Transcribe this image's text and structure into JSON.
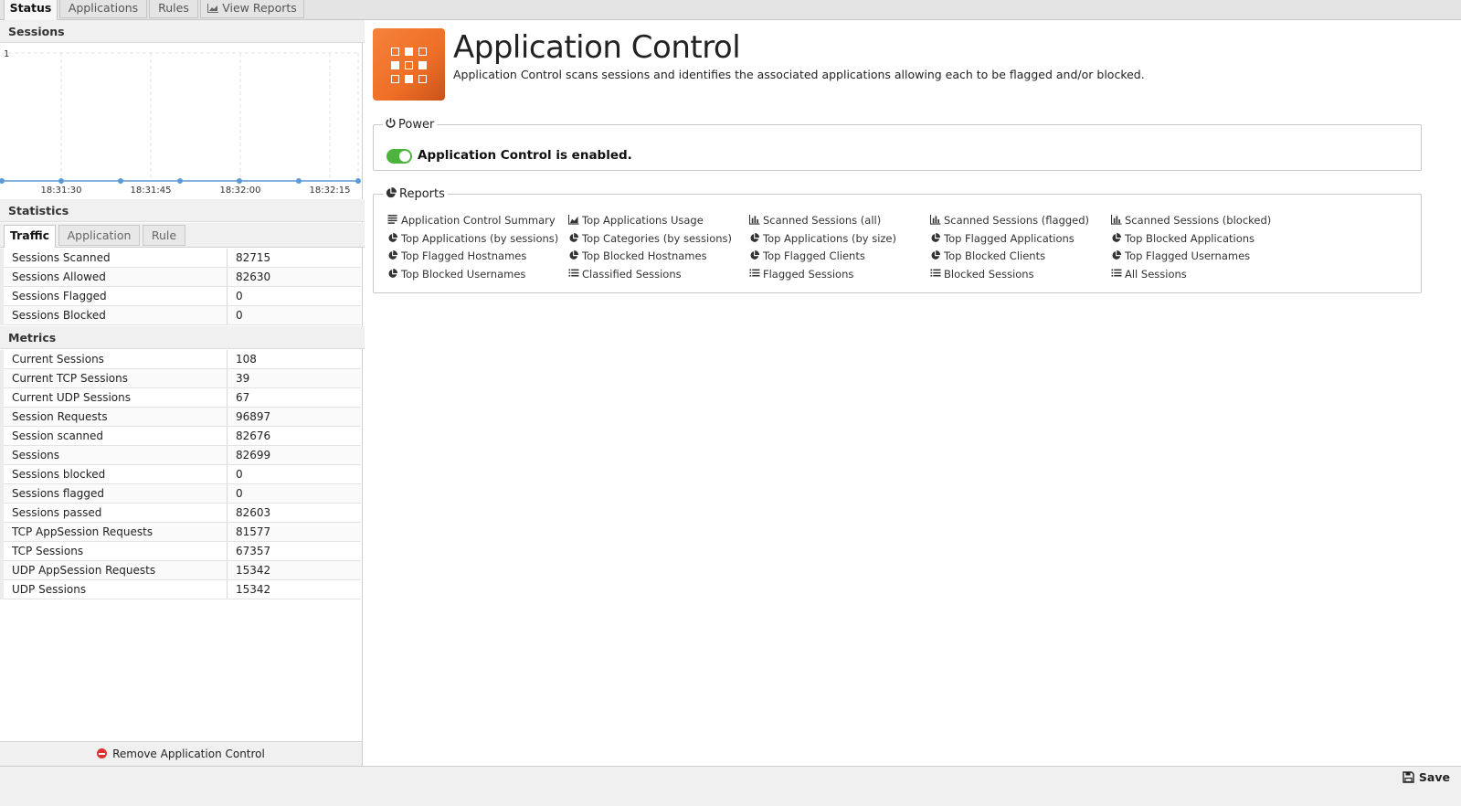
{
  "tabs": [
    {
      "label": "Status",
      "active": true
    },
    {
      "label": "Applications",
      "active": false
    },
    {
      "label": "Rules",
      "active": false
    },
    {
      "label": "View Reports",
      "active": false
    }
  ],
  "sessions": {
    "header": "Sessions",
    "chart_data": {
      "type": "line",
      "title": "",
      "x": [
        "18:31:30",
        "18:31:45",
        "18:32:00",
        "18:32:15"
      ],
      "ylim": [
        0,
        1
      ],
      "y_tick_labels": [
        "1"
      ],
      "series": [
        {
          "name": "",
          "values": [
            0,
            0,
            0,
            0,
            0,
            0,
            0
          ]
        }
      ],
      "grid": true,
      "legend": "none"
    }
  },
  "statistics": {
    "header": "Statistics",
    "tabs": [
      "Traffic",
      "Application",
      "Rule"
    ],
    "rows": [
      {
        "label": "Sessions Scanned",
        "value": "82715"
      },
      {
        "label": "Sessions Allowed",
        "value": "82630"
      },
      {
        "label": "Sessions Flagged",
        "value": "0"
      },
      {
        "label": "Sessions Blocked",
        "value": "0"
      }
    ]
  },
  "metrics": {
    "header": "Metrics",
    "rows": [
      {
        "label": "Current Sessions",
        "value": "108"
      },
      {
        "label": "Current TCP Sessions",
        "value": "39"
      },
      {
        "label": "Current UDP Sessions",
        "value": "67"
      },
      {
        "label": "Session Requests",
        "value": "96897"
      },
      {
        "label": "Session scanned",
        "value": "82676"
      },
      {
        "label": "Sessions",
        "value": "82699"
      },
      {
        "label": "Sessions blocked",
        "value": "0"
      },
      {
        "label": "Sessions flagged",
        "value": "0"
      },
      {
        "label": "Sessions passed",
        "value": "82603"
      },
      {
        "label": "TCP AppSession Requests",
        "value": "81577"
      },
      {
        "label": "TCP Sessions",
        "value": "67357"
      },
      {
        "label": "UDP AppSession Requests",
        "value": "15342"
      },
      {
        "label": "UDP Sessions",
        "value": "15342"
      }
    ]
  },
  "remove_label": "Remove Application Control",
  "app": {
    "title": "Application Control",
    "description": "Application Control scans sessions and identifies the associated applications allowing each to be flagged and/or blocked.",
    "icon": "app-grid-icon",
    "accent": "#f17a35"
  },
  "power": {
    "legend": "Power",
    "status": "Application Control is enabled.",
    "enabled": true
  },
  "reports": {
    "legend": "Reports",
    "items": [
      {
        "label": "Application Control Summary",
        "icon": "text"
      },
      {
        "label": "Top Applications Usage",
        "icon": "area"
      },
      {
        "label": "Scanned Sessions (all)",
        "icon": "bar"
      },
      {
        "label": "Scanned Sessions (flagged)",
        "icon": "bar"
      },
      {
        "label": "Scanned Sessions (blocked)",
        "icon": "bar"
      },
      {
        "label": "Top Applications (by sessions)",
        "icon": "pie"
      },
      {
        "label": "Top Categories (by sessions)",
        "icon": "pie"
      },
      {
        "label": "Top Applications (by size)",
        "icon": "pie"
      },
      {
        "label": "Top Flagged Applications",
        "icon": "pie"
      },
      {
        "label": "Top Blocked Applications",
        "icon": "pie"
      },
      {
        "label": "Top Flagged Hostnames",
        "icon": "pie"
      },
      {
        "label": "Top Blocked Hostnames",
        "icon": "pie"
      },
      {
        "label": "Top Flagged Clients",
        "icon": "pie"
      },
      {
        "label": "Top Blocked Clients",
        "icon": "pie"
      },
      {
        "label": "Top Flagged Usernames",
        "icon": "pie"
      },
      {
        "label": "Top Blocked Usernames",
        "icon": "pie"
      },
      {
        "label": "Classified Sessions",
        "icon": "list"
      },
      {
        "label": "Flagged Sessions",
        "icon": "list"
      },
      {
        "label": "Blocked Sessions",
        "icon": "list"
      },
      {
        "label": "All Sessions",
        "icon": "list"
      }
    ]
  },
  "save_label": "Save"
}
